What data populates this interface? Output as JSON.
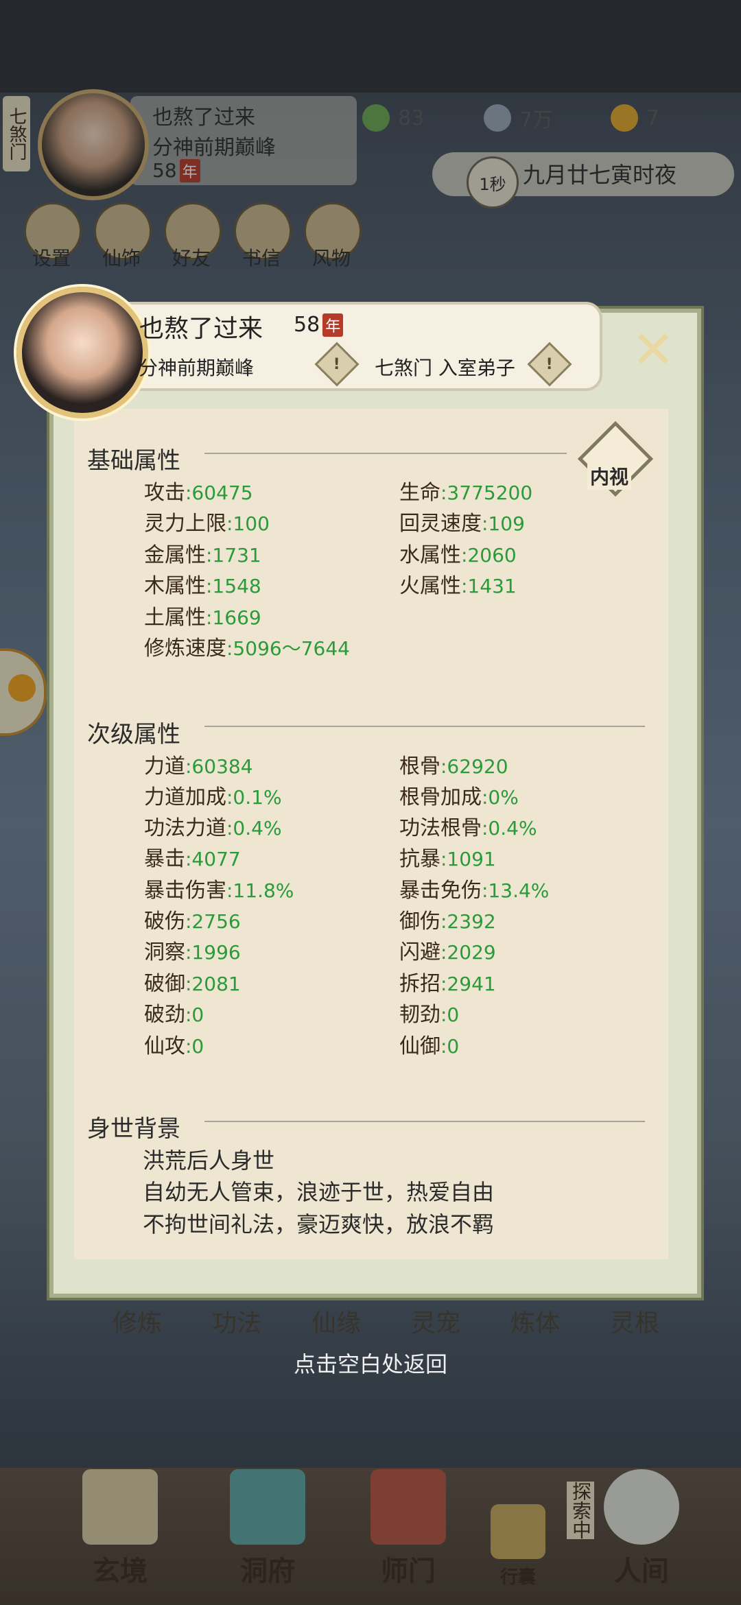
{
  "hud": {
    "sect_tag": "七煞门",
    "player_name": "也熬了过来",
    "player_rank": "分神前期巅峰",
    "player_age": "58",
    "age_unit": "年",
    "resources": [
      {
        "icon": "jade-leaf-icon",
        "value": "83"
      },
      {
        "icon": "coin-icon",
        "value": "7万"
      },
      {
        "icon": "trophy-icon",
        "value": "7"
      }
    ],
    "time_speed": "1秒",
    "date_text": "九月廿七寅时夜",
    "menu": [
      "设置",
      "仙饰",
      "好友",
      "书信",
      "风物"
    ]
  },
  "dialog": {
    "name": "也熬了过来",
    "age": "58",
    "age_unit": "年",
    "rank": "分神前期巅峰",
    "sect_role": "七煞门 入室弟子",
    "close_icon": "close-icon",
    "inner_view_label": "内视",
    "basic": {
      "title": "基础属性",
      "items": [
        {
          "label": "攻击",
          "value": ":60475"
        },
        {
          "label": "生命",
          "value": ":3775200"
        },
        {
          "label": "灵力上限",
          "value": ":100"
        },
        {
          "label": "回灵速度",
          "value": ":109"
        },
        {
          "label": "金属性",
          "value": ":1731"
        },
        {
          "label": "水属性",
          "value": ":2060"
        },
        {
          "label": "木属性",
          "value": ":1548"
        },
        {
          "label": "火属性",
          "value": ":1431"
        },
        {
          "label": "土属性",
          "value": ":1669"
        },
        {
          "label": "修炼速度",
          "value": ":5096〜7644"
        }
      ]
    },
    "secondary": {
      "title": "次级属性",
      "items": [
        {
          "label": "力道",
          "value": ":60384"
        },
        {
          "label": "根骨",
          "value": ":62920"
        },
        {
          "label": "力道加成",
          "value": ":0.1%"
        },
        {
          "label": "根骨加成",
          "value": ":0%"
        },
        {
          "label": "功法力道",
          "value": ":0.4%"
        },
        {
          "label": "功法根骨",
          "value": ":0.4%"
        },
        {
          "label": "暴击",
          "value": ":4077"
        },
        {
          "label": "抗暴",
          "value": ":1091"
        },
        {
          "label": "暴击伤害",
          "value": ":11.8%"
        },
        {
          "label": "暴击免伤",
          "value": ":13.4%"
        },
        {
          "label": "破伤",
          "value": ":2756"
        },
        {
          "label": "御伤",
          "value": ":2392"
        },
        {
          "label": "洞察",
          "value": ":1996"
        },
        {
          "label": "闪避",
          "value": ":2029"
        },
        {
          "label": "破御",
          "value": ":2081"
        },
        {
          "label": "拆招",
          "value": ":2941"
        },
        {
          "label": "破劲",
          "value": ":0"
        },
        {
          "label": "韧劲",
          "value": ":0"
        },
        {
          "label": "仙攻",
          "value": ":0"
        },
        {
          "label": "仙御",
          "value": ":0"
        }
      ]
    },
    "background": {
      "title": "身世背景",
      "lines": [
        "洪荒后人身世",
        "自幼无人管束，浪迹于世，热爱自由",
        "不拘世间礼法，豪迈爽快，放浪不羁"
      ]
    }
  },
  "back_hint": "点击空白处返回",
  "mid_row": [
    "修炼",
    "功法",
    "仙缘",
    "灵宠",
    "炼体",
    "灵根"
  ],
  "bottom_nav": [
    "玄境",
    "洞府",
    "师门",
    "行囊",
    "人间"
  ],
  "explore_label": "探索中"
}
